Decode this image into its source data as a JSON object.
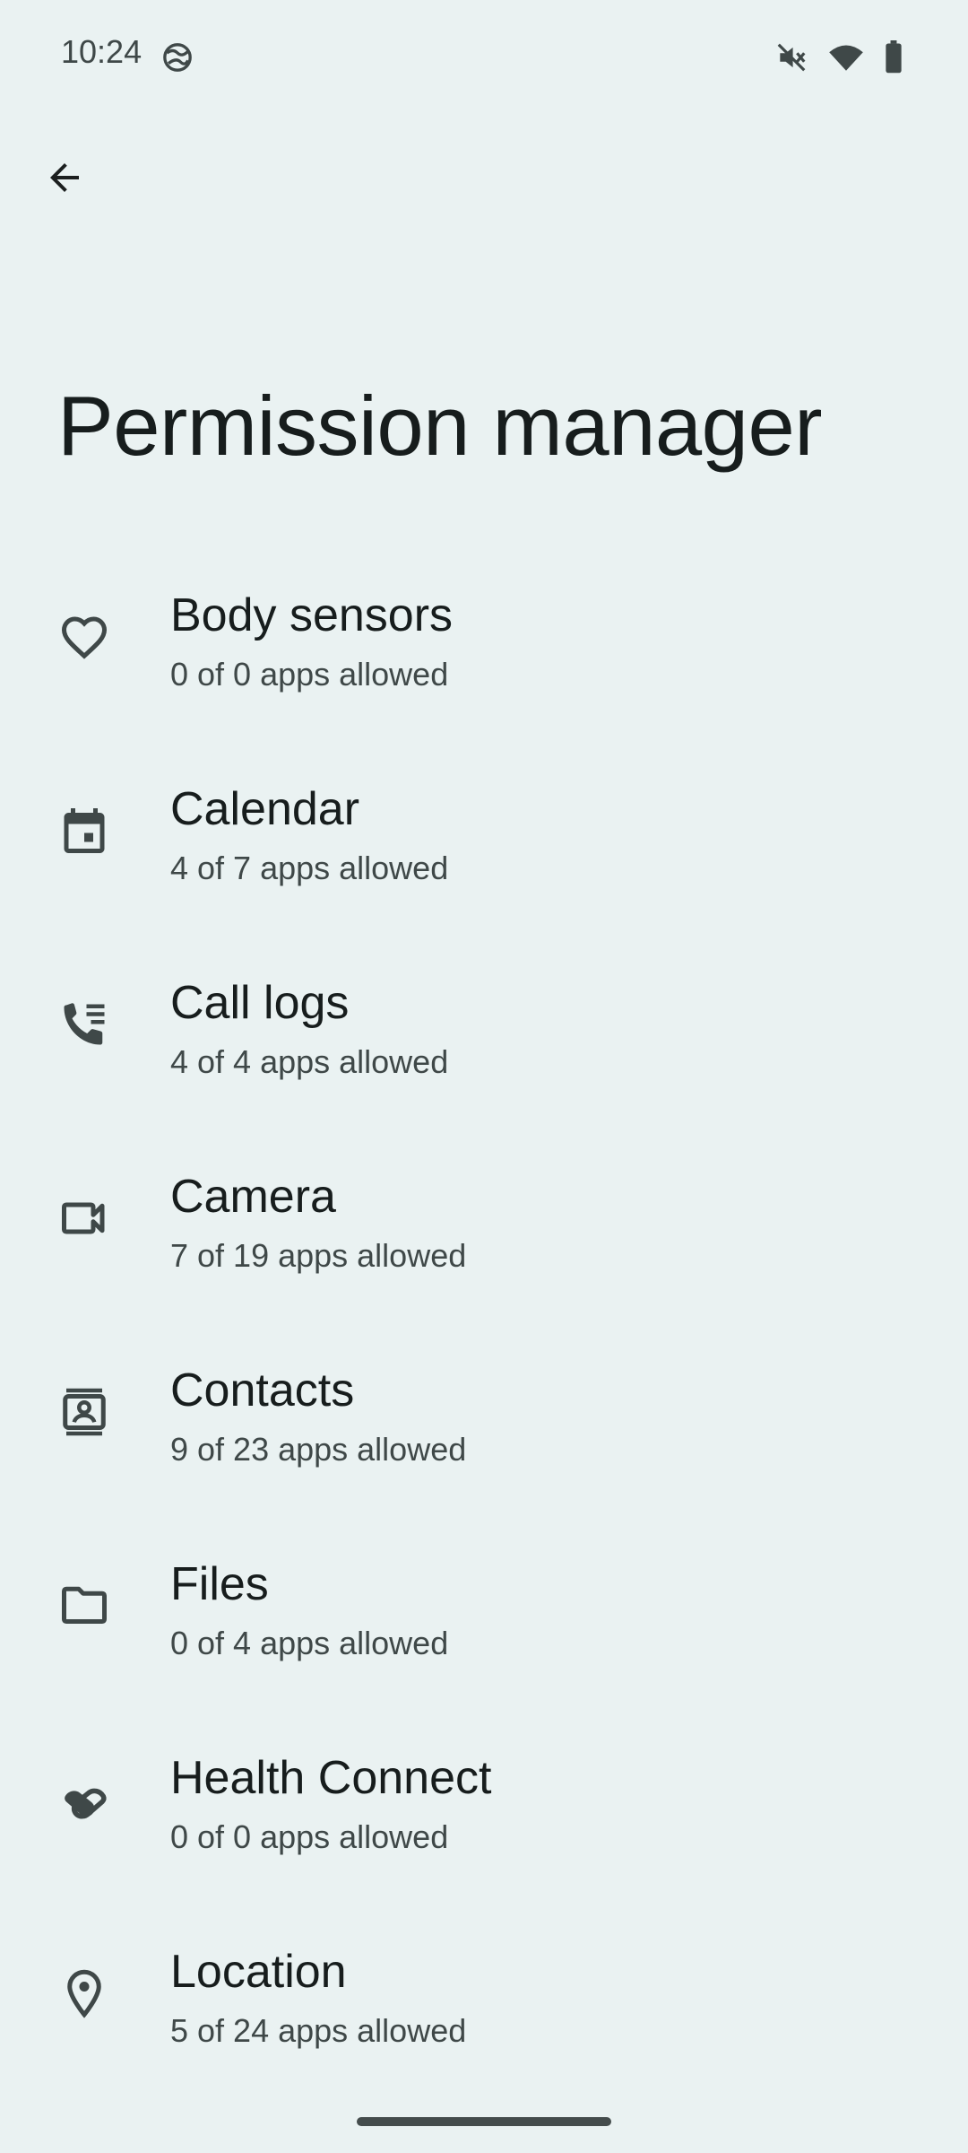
{
  "status_bar": {
    "time": "10:24",
    "left_icon": "vpn-globe-icon",
    "right_icons": [
      "mute-icon",
      "wifi-icon",
      "battery-icon"
    ]
  },
  "header": {
    "back_icon": "arrow-back-icon",
    "title": "Permission manager"
  },
  "permissions": [
    {
      "label": "Body sensors",
      "summary": "0 of 0 apps allowed",
      "icon": "heart-icon"
    },
    {
      "label": "Calendar",
      "summary": "4 of 7 apps allowed",
      "icon": "calendar-icon"
    },
    {
      "label": "Call logs",
      "summary": "4 of 4 apps allowed",
      "icon": "call-log-icon"
    },
    {
      "label": "Camera",
      "summary": "7 of 19 apps allowed",
      "icon": "camera-icon"
    },
    {
      "label": "Contacts",
      "summary": "9 of 23 apps allowed",
      "icon": "contacts-icon"
    },
    {
      "label": "Files",
      "summary": "0 of 4 apps allowed",
      "icon": "folder-icon"
    },
    {
      "label": "Health Connect",
      "summary": "0 of 0 apps allowed",
      "icon": "health-connect-icon"
    },
    {
      "label": "Location",
      "summary": "5 of 24 apps allowed",
      "icon": "location-icon"
    }
  ],
  "colors": {
    "background": "#eaf2f2",
    "text_primary": "#171d1d",
    "text_secondary": "#3f4848",
    "icon": "#3f4848"
  }
}
